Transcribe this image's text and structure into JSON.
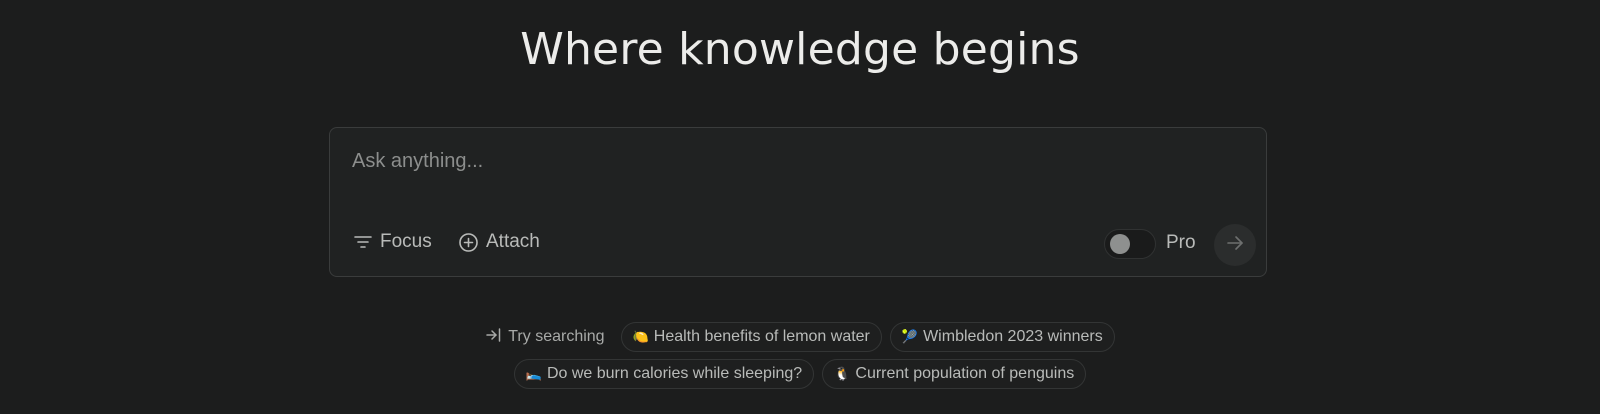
{
  "hero": {
    "title": "Where knowledge begins"
  },
  "search": {
    "placeholder": "Ask anything...",
    "value": "",
    "focus_label": "Focus",
    "attach_label": "Attach",
    "pro_label": "Pro",
    "pro_enabled": false,
    "submit_icon": "arrow-right-icon"
  },
  "suggestions": {
    "intro_label": "Try searching",
    "intro_icon": "arrow-into-icon",
    "items": [
      {
        "emoji": "🍋",
        "label": "Health benefits of lemon water"
      },
      {
        "emoji": "🎾",
        "label": "Wimbledon 2023 winners"
      },
      {
        "emoji": "🛌",
        "label": "Do we burn calories while sleeping?"
      },
      {
        "emoji": "🐧",
        "label": "Current population of penguins"
      }
    ]
  },
  "colors": {
    "background": "#1c1d1d",
    "search_box": "#202222",
    "border": "#3a3c3c",
    "text_primary": "#ececea",
    "text_muted": "#b9bbb9"
  }
}
